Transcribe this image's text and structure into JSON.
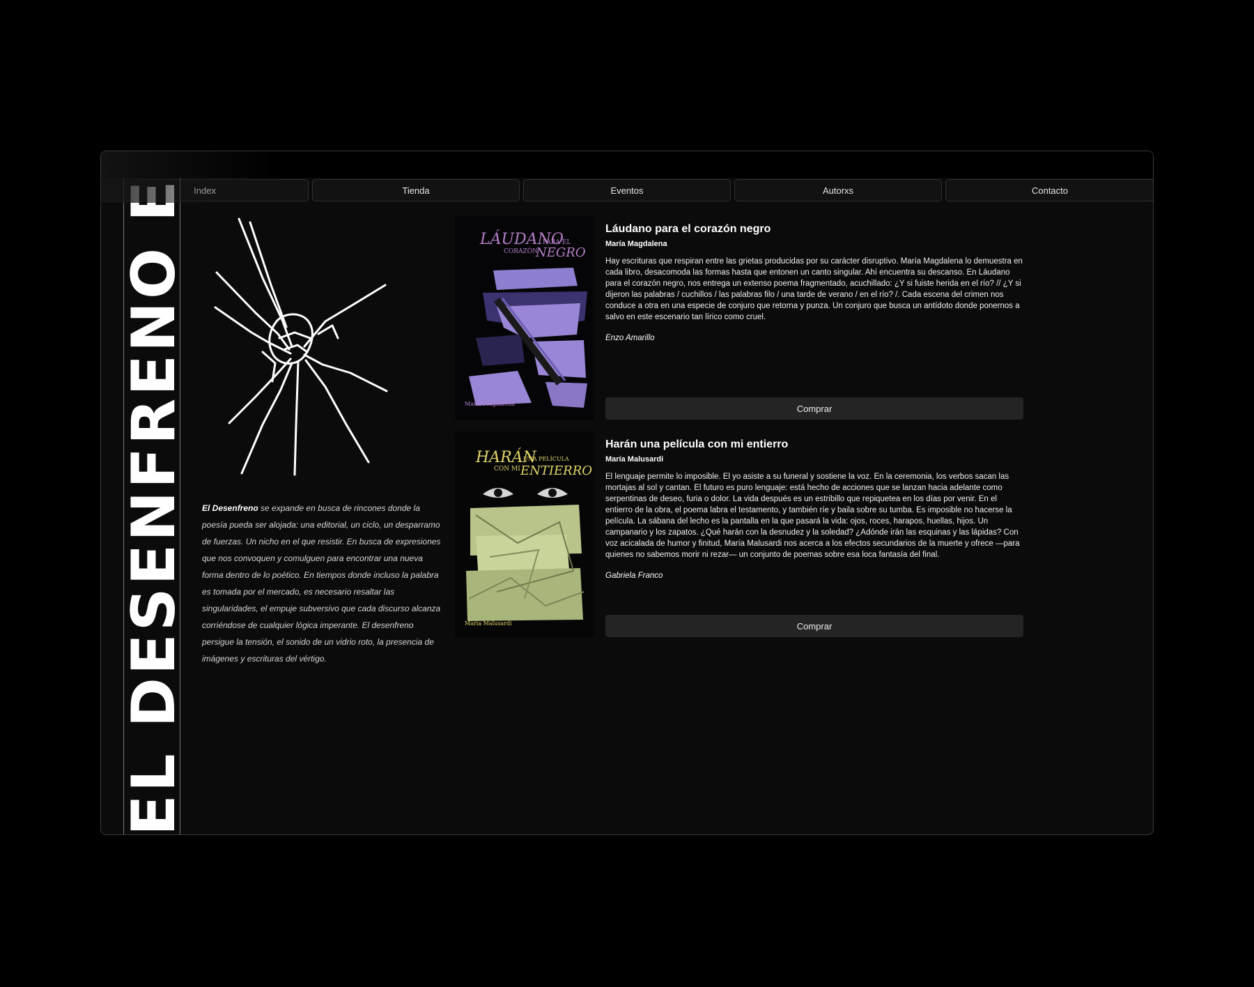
{
  "nav": {
    "items": [
      {
        "label": "Index"
      },
      {
        "label": "Tienda"
      },
      {
        "label": "Eventos"
      },
      {
        "label": "Autorxs"
      },
      {
        "label": "Contacto"
      }
    ]
  },
  "brand": {
    "vertical_text": "EL DESENFRENO EL DE"
  },
  "about": {
    "brand_name": "El Desenfreno",
    "text": " se expande en busca de rincones donde la poesía pueda ser alojada: una editorial, un ciclo, un desparramo de fuerzas. Un nicho en el que resistir. En busca de expresiones que nos convoquen y comulguen para encontrar una nueva forma dentro de lo poético. En tiempos donde incluso la palabra es tomada por el mercado, es necesario resaltar las singularidades, el empuje subversivo que cada discurso alcanza corriéndose de cualquier lógica imperante. El desenfreno persigue la tensión, el sonido de un vidrio roto, la presencia de imágenes y escrituras del vértigo."
  },
  "books": [
    {
      "cover_title_main": "LÁUDANO",
      "cover_title_small": "PARA EL",
      "cover_title_line2a": "CORAZÓN",
      "cover_title_line2b": "NEGRO",
      "cover_author": "María Magdalena",
      "title": "Láudano para el corazón negro",
      "author": "María Magdalena",
      "description": "Hay escrituras que respiran entre las grietas producidas por su carácter disruptivo. María Magdalena lo demuestra en cada libro, desacomoda las formas hasta que entonen un canto singular. Ahí encuentra su descanso. En Láudano para el corazón negro, nos entrega un extenso poema fragmentado, acuchillado: ¿Y si fuiste herida en el río? // ¿Y si dijeron las palabras / cuchillos / las palabras filo / una tarde de verano / en el río? /. Cada escena del crimen nos conduce a otra en una especie de conjuro que retorna y punza. Un conjuro que busca un antídoto donde ponernos a salvo en este escenario tan lírico como cruel.",
      "reviewer": "Enzo Amarillo",
      "buy_label": "Comprar",
      "accent": "#9a86d6"
    },
    {
      "cover_title_main": "HARÁN",
      "cover_title_small": "UNA PELÍCULA",
      "cover_title_line2a": "CON MI",
      "cover_title_line2b": "ENTIERRO",
      "cover_author": "María Malusardi",
      "title": "Harán una película con mi entierro",
      "author": "María Malusardi",
      "description": "El lenguaje permite lo imposible. El yo asiste a su funeral y sostiene la voz. En la ceremonia, los verbos sacan las mortajas al sol y cantan. El futuro es puro lenguaje: está hecho de acciones que se lanzan hacia adelante como serpentinas de deseo, furia o dolor. La vida después es un estribillo que repiquetea en los días por venir. En el entierro de la obra, el poema labra el testamento, y también ríe y baila sobre su tumba. Es imposible no hacerse la película. La sábana del lecho es la pantalla en la que pasará la vida: ojos, roces, harapos, huellas, hijos. Un campanario y los zapatos. ¿Qué harán con la desnudez y la soledad? ¿Adónde irán las esquinas y las lápidas? Con voz acicalada de humor y finitud, María Malusardi nos acerca a los efectos secundarios de la muerte y ofrece —para quienes no sabemos morir ni rezar— un conjunto de poemas sobre esa loca fantasía del final.",
      "reviewer": "Gabriela Franco",
      "buy_label": "Comprar",
      "accent": "#c7d49a"
    }
  ]
}
